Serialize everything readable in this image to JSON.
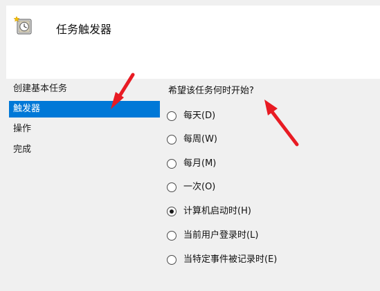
{
  "header": {
    "title": "任务触发器",
    "icon": "scheduled-task-clock-icon"
  },
  "sidebar": {
    "items": [
      {
        "label": "创建基本任务",
        "active": false
      },
      {
        "label": "触发器",
        "active": true
      },
      {
        "label": "操作",
        "active": false
      },
      {
        "label": "完成",
        "active": false
      }
    ]
  },
  "main": {
    "question": "希望该任务何时开始?",
    "options": [
      {
        "label": "每天(D)",
        "checked": false
      },
      {
        "label": "每周(W)",
        "checked": false
      },
      {
        "label": "每月(M)",
        "checked": false
      },
      {
        "label": "一次(O)",
        "checked": false
      },
      {
        "label": "计算机启动时(H)",
        "checked": true
      },
      {
        "label": "当前用户登录时(L)",
        "checked": false
      },
      {
        "label": "当特定事件被记录时(E)",
        "checked": false
      }
    ]
  },
  "colors": {
    "selected_nav": "#0078d7",
    "annotation_arrow": "#e81b23"
  }
}
